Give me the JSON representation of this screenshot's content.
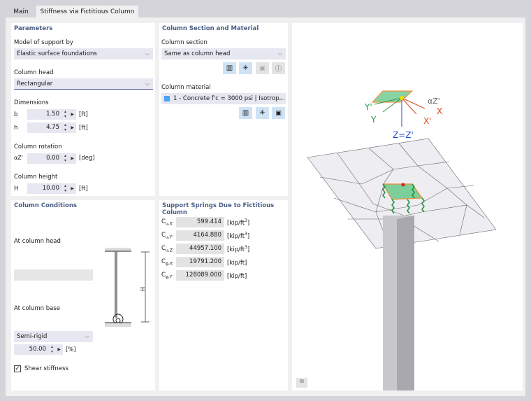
{
  "tabs": [
    {
      "label": "Main"
    },
    {
      "label": "Stiffness via Fictitious Column"
    }
  ],
  "parameters": {
    "title": "Parameters",
    "model_label": "Model of support by",
    "model_value": "Elastic surface foundations",
    "head_label": "Column head",
    "head_value": "Rectangular",
    "dimensions_label": "Dimensions",
    "b": {
      "label": "b",
      "value": "1.50",
      "unit": "[ft]"
    },
    "h": {
      "label": "h",
      "value": "4.75",
      "unit": "[ft]"
    },
    "rotation_label": "Column rotation",
    "rotation": {
      "label": "αZ'",
      "value": "0.00",
      "unit": "[deg]"
    },
    "height_label": "Column height",
    "H": {
      "label": "H",
      "value": "10.00",
      "unit": "[ft]"
    }
  },
  "section": {
    "title": "Column Section and Material",
    "section_label": "Column section",
    "section_value": "Same as column head",
    "material_label": "Column material",
    "material_value": "1 - Concrete f'c = 3000 psi | Isotrop...",
    "material_color": "#4da3f0"
  },
  "conditions": {
    "title": "Column Conditions",
    "head_label": "At column head",
    "base_label": "At column base",
    "base_value": "Semi-rigid",
    "percent": {
      "value": "50.00",
      "unit": "[%]"
    },
    "shear_label": "Shear stiffness",
    "shear_checked": true,
    "diagram_H": "H"
  },
  "springs": {
    "title": "Support Springs Due to Fictitious Column",
    "rows": [
      {
        "sym": "C",
        "sub": "u,X'",
        "value": "599.414",
        "unit": "[kip/ft",
        "sup": "3",
        "end": "]"
      },
      {
        "sym": "C",
        "sub": "u,Y'",
        "value": "4164.880",
        "unit": "[kip/ft",
        "sup": "3",
        "end": "]"
      },
      {
        "sym": "C",
        "sub": "u,Z'",
        "value": "44957.100",
        "unit": "[kip/ft",
        "sup": "3",
        "end": "]"
      },
      {
        "sym": "C",
        "sub": "φ,X'",
        "value": "19791.200",
        "unit": "[kip/ft]",
        "sup": "",
        "end": ""
      },
      {
        "sym": "C",
        "sub": "φ,Y'",
        "value": "128089.000",
        "unit": "[kip/ft]",
        "sup": "",
        "end": ""
      }
    ]
  },
  "graphic": {
    "axes": {
      "y_prime": "Y'",
      "y": "Y",
      "x": "X",
      "x_prime": "X'",
      "z": "Z=Z'",
      "alpha": "αZ'"
    }
  }
}
